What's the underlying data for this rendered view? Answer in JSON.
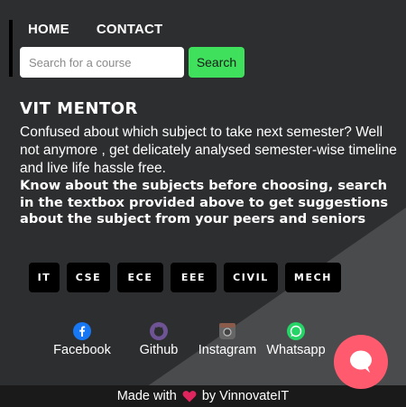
{
  "nav": {
    "items": [
      {
        "label": "HOME"
      },
      {
        "label": "CONTACT"
      }
    ]
  },
  "search": {
    "placeholder": "Search for a course",
    "value": "",
    "button_label": "Search"
  },
  "hero": {
    "title": "VIT MENTOR",
    "description": "Confused about which subject to take next semester? Well not anymore , get delicately analysed semester-wise timeline and live life hassle free.",
    "bold_text": "Know about the subjects before choosing, search in the textbox provided above to get suggestions about the subject from your peers and seniors"
  },
  "branches": [
    {
      "label": "IT"
    },
    {
      "label": "CSE"
    },
    {
      "label": "ECE"
    },
    {
      "label": "EEE"
    },
    {
      "label": "CIVIL"
    },
    {
      "label": "MECH"
    }
  ],
  "socials": [
    {
      "label": "Facebook",
      "icon": "facebook-icon",
      "color": "#1877f2"
    },
    {
      "label": "Github",
      "icon": "github-icon",
      "color": "#6e5494"
    },
    {
      "label": "Instagram",
      "icon": "instagram-icon",
      "color": "#666666"
    },
    {
      "label": "Whatsapp",
      "icon": "whatsapp-icon",
      "color": "#25d366"
    }
  ],
  "footer": {
    "prefix": "Made with",
    "suffix": "by VinnovateIT",
    "icon": "heart-icon"
  },
  "chat": {
    "icon": "chat-bubble-icon",
    "color": "#ff5a6e"
  },
  "colors": {
    "background": "#2d2e30",
    "diagonal": "#4a4a4c",
    "accent_green": "#3ee05c"
  }
}
